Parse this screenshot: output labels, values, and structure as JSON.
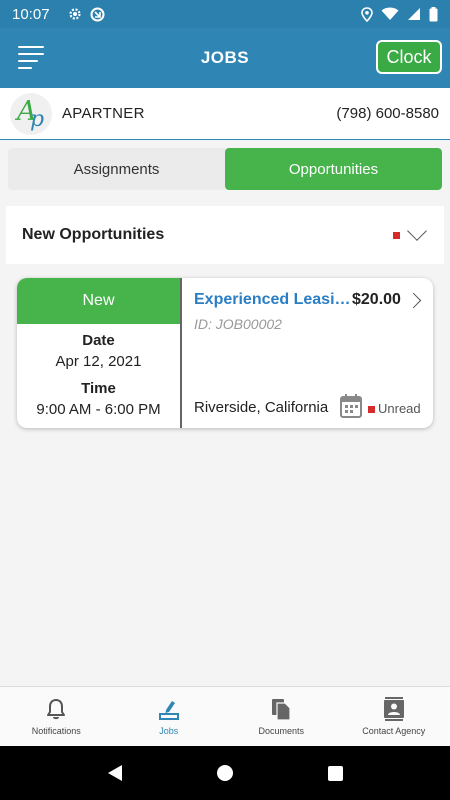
{
  "status_bar": {
    "time": "10:07",
    "icons": [
      "gear-icon",
      "sync-icon",
      "location-icon",
      "wifi-icon",
      "signal-icon",
      "battery-icon"
    ]
  },
  "app_bar": {
    "title": "JOBS",
    "clock_label": "Clock",
    "menu_icon": "menu-icon"
  },
  "partner": {
    "name": "APARTNER",
    "phone": "(798) 600-8580",
    "logo_text_a": "A",
    "logo_text_p": "p"
  },
  "tabs": [
    {
      "label": "Assignments",
      "active": false
    },
    {
      "label": "Opportunities",
      "active": true
    }
  ],
  "section": {
    "title": "New Opportunities"
  },
  "job": {
    "status": "New",
    "date_label": "Date",
    "date": "Apr 12, 2021",
    "time_label": "Time",
    "time": "9:00 AM - 6:00 PM",
    "title": "Experienced Leasing Agent",
    "price": "$20.00",
    "id": "ID: JOB00002",
    "location": "Riverside, California",
    "read_status": "Unread"
  },
  "bottom_nav": [
    {
      "label": "Notifications",
      "icon": "bell-icon",
      "active": false
    },
    {
      "label": "Jobs",
      "icon": "jobs-icon",
      "active": true
    },
    {
      "label": "Documents",
      "icon": "documents-icon",
      "active": false
    },
    {
      "label": "Contact Agency",
      "icon": "contact-icon",
      "active": false
    }
  ],
  "colors": {
    "primary": "#2f86b5",
    "accent_green": "#46b34b",
    "link_blue": "#2a7ec4",
    "unread_red": "#d62b2b"
  }
}
